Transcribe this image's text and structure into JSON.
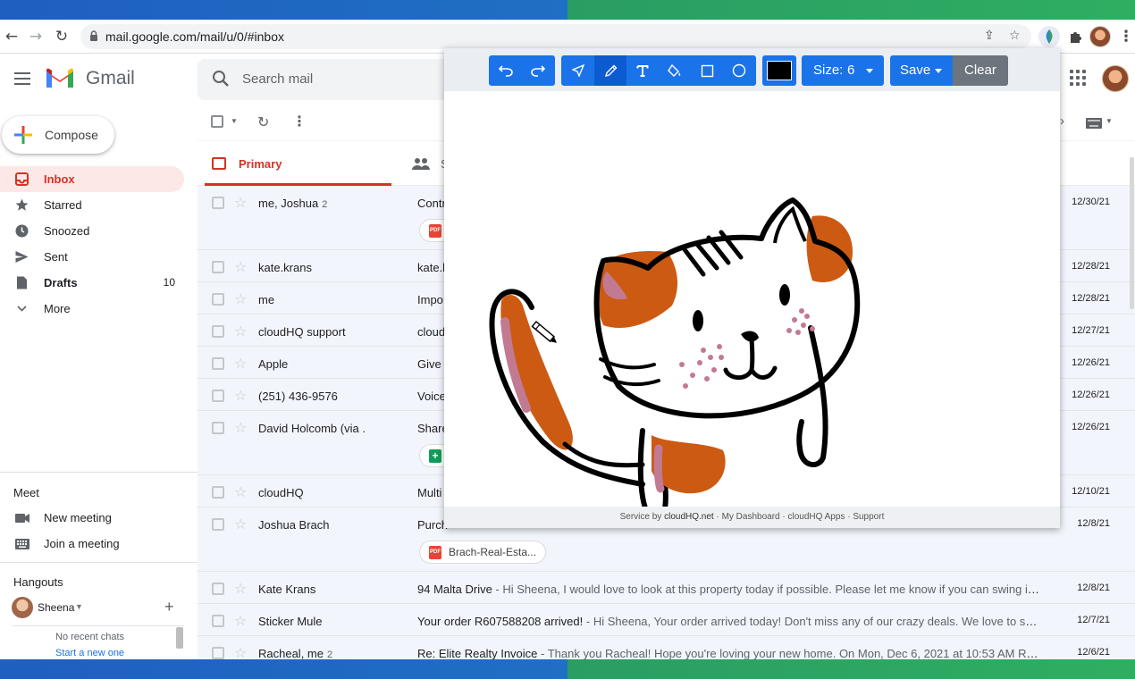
{
  "browser": {
    "url": "mail.google.com/mail/u/0/#inbox"
  },
  "gmail": {
    "brand": "Gmail",
    "search_placeholder": "Search mail",
    "compose_label": "Compose",
    "nav": [
      {
        "label": "Inbox",
        "count": "",
        "icon": "inbox-icon"
      },
      {
        "label": "Starred",
        "count": "",
        "icon": "star-icon"
      },
      {
        "label": "Snoozed",
        "count": "",
        "icon": "clock-icon"
      },
      {
        "label": "Sent",
        "count": "",
        "icon": "send-icon"
      },
      {
        "label": "Drafts",
        "count": "10",
        "icon": "draft-icon"
      },
      {
        "label": "More",
        "count": "",
        "icon": "chevron-down-icon"
      }
    ],
    "meet": {
      "title": "Meet",
      "new_meeting": "New meeting",
      "join_meeting": "Join a meeting"
    },
    "hangouts": {
      "title": "Hangouts",
      "user": "Sheena",
      "no_chats": "No recent chats",
      "start_chat": "Start a new one"
    },
    "tabs": {
      "primary": "Primary",
      "social_partial": "S"
    },
    "emails": [
      {
        "sender": "me, Joshua",
        "count": "2",
        "subject": "Contr",
        "snippet": "",
        "date": "12/30/21",
        "attachment": "pdf"
      },
      {
        "sender": "kate.krans",
        "count": "",
        "subject": "kate.l",
        "snippet": "",
        "date": "12/28/21",
        "attachment": ""
      },
      {
        "sender": "me",
        "count": "",
        "subject": "Impo",
        "snippet": "",
        "date": "12/28/21",
        "attachment": ""
      },
      {
        "sender": "cloudHQ support",
        "count": "",
        "subject": "cloud",
        "snippet": "",
        "date": "12/27/21",
        "attachment": ""
      },
      {
        "sender": "Apple",
        "count": "",
        "subject": "Give y",
        "snippet": "",
        "date": "12/26/21",
        "attachment": ""
      },
      {
        "sender": "(251) 436-9576",
        "count": "",
        "subject": "Voice",
        "snippet": "",
        "date": "12/26/21",
        "attachment": ""
      },
      {
        "sender": "David Holcomb (via .",
        "count": "",
        "subject": "Share",
        "snippet": "",
        "date": "12/26/21",
        "attachment": "sheet"
      },
      {
        "sender": "cloudHQ",
        "count": "",
        "subject": "Multi",
        "snippet": "",
        "date": "12/10/21",
        "attachment": ""
      },
      {
        "sender": "Joshua Brach",
        "count": "",
        "subject": "Purch",
        "snippet": "",
        "date": "12/8/21",
        "attachment": "pdf",
        "attachment_name": "Brach-Real-Esta..."
      },
      {
        "sender": "Kate Krans",
        "count": "",
        "subject": "94 Malta Drive",
        "snippet": " - Hi Sheena, I would love to look at this property today if possible. Please let me know if you can swing it. ...",
        "date": "12/8/21",
        "attachment": ""
      },
      {
        "sender": "Sticker Mule",
        "count": "",
        "subject": "Your order R607588208 arrived!",
        "snippet": " - Hi Sheena, Your order arrived today! Don't miss any of our crazy deals. We love to surpri...",
        "date": "12/7/21",
        "attachment": ""
      },
      {
        "sender": "Racheal, me",
        "count": "2",
        "subject": "Re: Elite Realty Invoice",
        "snippet": " - Thank you Racheal! Hope you're loving your new home. On Mon, Dec 6, 2021 at 10:53 AM Rache...",
        "date": "12/6/21",
        "attachment": ""
      }
    ]
  },
  "drawing": {
    "size_label": "Size:",
    "size_value": "6",
    "save_label": "Save",
    "clear_label": "Clear",
    "current_color": "#000000",
    "active_tool": "pencil",
    "footer": {
      "prefix": "Service by ",
      "service": "cloudHQ.net",
      "sep1": " · ",
      "dashboard": "My Dashboard",
      "sep2": " · ",
      "apps": "cloudHQ Apps",
      "sep3": " · ",
      "support": "Support"
    }
  },
  "colors": {
    "accent_red": "#d93025",
    "toolbar_blue": "#1a73e8",
    "cat_orange": "#cc5a12",
    "cat_pink": "#c27a93"
  }
}
